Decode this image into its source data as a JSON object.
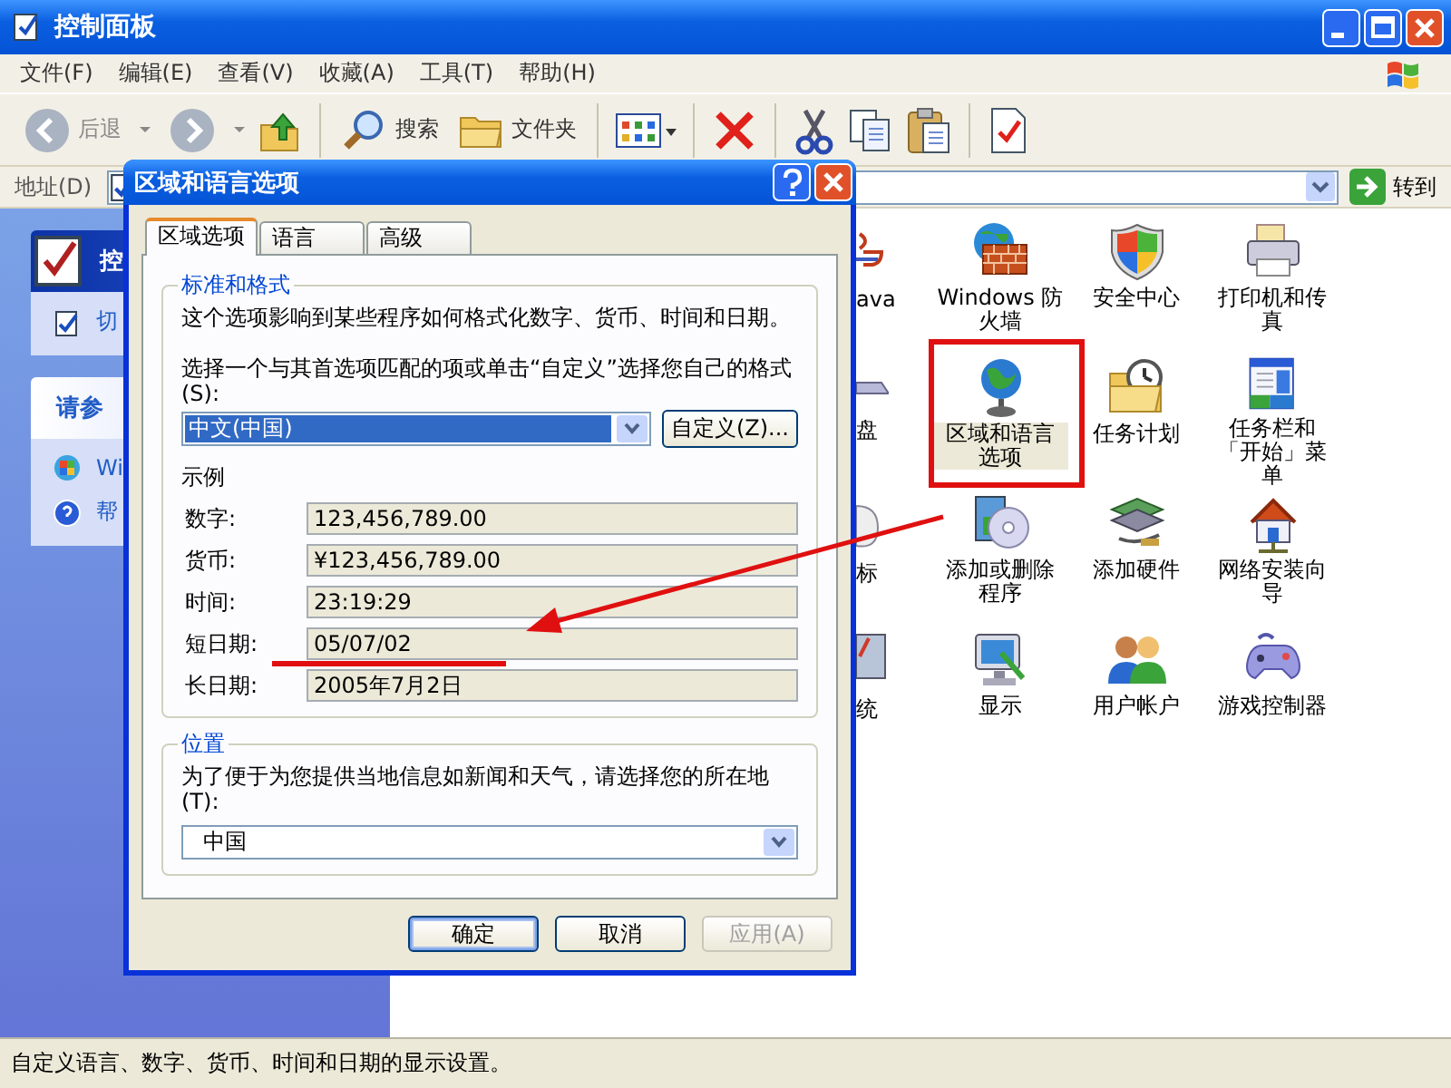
{
  "window": {
    "title": "控制面板"
  },
  "menu": [
    "文件(F)",
    "编辑(E)",
    "查看(V)",
    "收藏(A)",
    "工具(T)",
    "帮助(H)"
  ],
  "toolbar": {
    "back": "后退",
    "search": "搜索",
    "folders": "文件夹"
  },
  "address": {
    "label": "地址(D)",
    "go": "转到"
  },
  "sidebar": {
    "panels": [
      {
        "title": "控",
        "items": [
          "切"
        ]
      },
      {
        "title": "请参",
        "items": [
          "Wi",
          "帮"
        ]
      }
    ]
  },
  "cut_column": [
    "ava",
    "盘",
    "标",
    "统"
  ],
  "icons": [
    {
      "label": "Windows 防火墙",
      "selected": false
    },
    {
      "label": "安全中心",
      "selected": false
    },
    {
      "label": "打印机和传真",
      "selected": false
    },
    {
      "label": "区域和语言选项",
      "selected": true
    },
    {
      "label": "任务计划",
      "selected": false
    },
    {
      "label": "任务栏和「开始」菜单",
      "selected": false
    },
    {
      "label": "添加或删除程序",
      "selected": false
    },
    {
      "label": "添加硬件",
      "selected": false
    },
    {
      "label": "网络安装向导",
      "selected": false
    },
    {
      "label": "显示",
      "selected": false
    },
    {
      "label": "用户帐户",
      "selected": false
    },
    {
      "label": "游戏控制器",
      "selected": false
    }
  ],
  "dialog": {
    "title": "区域和语言选项",
    "tabs": [
      {
        "label": "区域选项",
        "selected": true
      },
      {
        "label": "语言",
        "selected": false
      },
      {
        "label": "高级",
        "selected": false
      }
    ],
    "format_group": {
      "title": "标准和格式",
      "description": "这个选项影响到某些程序如何格式化数字、货币、时间和日期。",
      "prompt": "选择一个与其首选项匹配的项或单击“自定义”选择您自己的格式(S):",
      "format": "中文(中国)",
      "customize": "自定义(Z)...",
      "samples_title": "示例",
      "samples": [
        {
          "label": "数字:",
          "value": "123,456,789.00"
        },
        {
          "label": "货币:",
          "value": "¥123,456,789.00"
        },
        {
          "label": "时间:",
          "value": "23:19:29"
        },
        {
          "label": "短日期:",
          "value": "05/07/02"
        },
        {
          "label": "长日期:",
          "value": "2005年7月2日"
        }
      ]
    },
    "location_group": {
      "title": "位置",
      "prompt": "为了便于为您提供当地信息如新闻和天气，请选择您的所在地(T):",
      "location": "中国"
    },
    "buttons": [
      {
        "label": "确定",
        "disabled": false
      },
      {
        "label": "取消",
        "disabled": false
      },
      {
        "label": "应用(A)",
        "disabled": true
      }
    ]
  },
  "status_bar": "自定义语言、数字、货币、时间和日期的显示设置。"
}
